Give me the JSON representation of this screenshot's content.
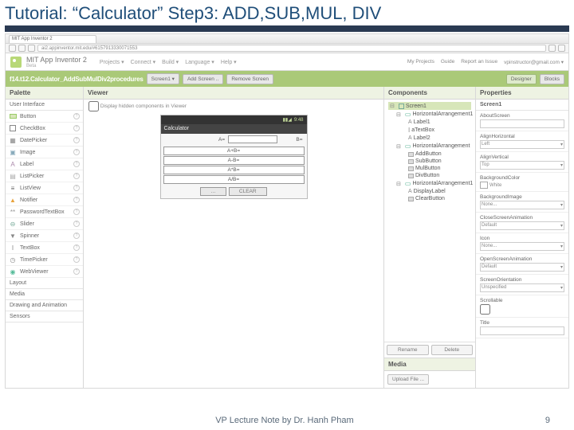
{
  "slide": {
    "title_prefix": "Tutorial: “Calculator” Step3: ",
    "title_bold": "ADD,SUB,MUL, DIV"
  },
  "browser": {
    "tab": "MIT App Inventor 2",
    "url": "ai2.appinventor.mit.edu/#6157913330071553"
  },
  "header": {
    "brand": "MIT App Inventor 2",
    "beta": "Beta",
    "menu": [
      "Projects ▾",
      "Connect ▾",
      "Build ▾",
      "Language ▾",
      "Help ▾"
    ],
    "right": [
      "My Projects",
      "Guide",
      "Report an Issue",
      "vpinstructor@gmail.com ▾"
    ]
  },
  "greenbar": {
    "project": "f14.t12.Calculator_AddSubMulDiv2procedures",
    "screen_btn": "Screen1 ▾",
    "add_screen": "Add Screen ..",
    "remove": "Remove Screen",
    "designer": "Designer",
    "blocks": "Blocks"
  },
  "palette": {
    "title": "Palette",
    "section": "User Interface",
    "items": [
      "Button",
      "CheckBox",
      "DatePicker",
      "Image",
      "Label",
      "ListPicker",
      "ListView",
      "Notifier",
      "PasswordTextBox",
      "Slider",
      "Spinner",
      "TextBox",
      "TimePicker",
      "WebViewer"
    ],
    "sections_more": [
      "Layout",
      "Media",
      "Drawing and Animation",
      "Sensors"
    ]
  },
  "viewer": {
    "title": "Viewer",
    "hidden_chk": "Display hidden components in Viewer",
    "statusbar_time": "9:48",
    "app_title": "Calculator",
    "row1_a": "A=",
    "row1_b": "B=",
    "res1": "A+B=",
    "res2": "A-B=",
    "res3": "A*B=",
    "res4": "A/B=",
    "btn_dots": "…",
    "btn_clear": "CLEAR"
  },
  "components": {
    "title": "Components",
    "tree": [
      {
        "l": 0,
        "t": "Screen1",
        "k": "screen"
      },
      {
        "l": 1,
        "t": "HorizontalArrangement1",
        "k": "h"
      },
      {
        "l": 2,
        "t": "Label1",
        "k": "A"
      },
      {
        "l": 2,
        "t": "aTextBox",
        "k": "I"
      },
      {
        "l": 2,
        "t": "Label2",
        "k": "A"
      },
      {
        "l": 1,
        "t": "HorizontalArrangement",
        "k": "h"
      },
      {
        "l": 2,
        "t": "AddButton",
        "k": "b"
      },
      {
        "l": 2,
        "t": "SubButton",
        "k": "b"
      },
      {
        "l": 2,
        "t": "MulButton",
        "k": "b"
      },
      {
        "l": 2,
        "t": "DivButton",
        "k": "b"
      },
      {
        "l": 1,
        "t": "HorizontalArrangement1",
        "k": "h"
      },
      {
        "l": 2,
        "t": "DisplayLabel",
        "k": "A"
      },
      {
        "l": 2,
        "t": "ClearButton",
        "k": "b"
      }
    ],
    "rename": "Rename",
    "delete": "Delete",
    "media_title": "Media",
    "upload": "Upload File ..."
  },
  "properties": {
    "title": "Properties",
    "target": "Screen1",
    "fields": [
      {
        "label": "AboutScreen",
        "type": "text",
        "value": ""
      },
      {
        "label": "AlignHorizontal",
        "type": "select",
        "value": "Left"
      },
      {
        "label": "AlignVertical",
        "type": "select",
        "value": "Top"
      },
      {
        "label": "BackgroundColor",
        "type": "color",
        "value": "White"
      },
      {
        "label": "BackgroundImage",
        "type": "select",
        "value": "None..."
      },
      {
        "label": "CloseScreenAnimation",
        "type": "select",
        "value": "Default"
      },
      {
        "label": "Icon",
        "type": "select",
        "value": "None..."
      },
      {
        "label": "OpenScreenAnimation",
        "type": "select",
        "value": "Default"
      },
      {
        "label": "ScreenOrientation",
        "type": "select",
        "value": "Unspecified"
      },
      {
        "label": "Scrollable",
        "type": "check",
        "value": ""
      },
      {
        "label": "Title",
        "type": "text",
        "value": ""
      }
    ]
  },
  "footer": {
    "note": "VP Lecture Note by Dr. Hanh Pham",
    "page": "9"
  }
}
